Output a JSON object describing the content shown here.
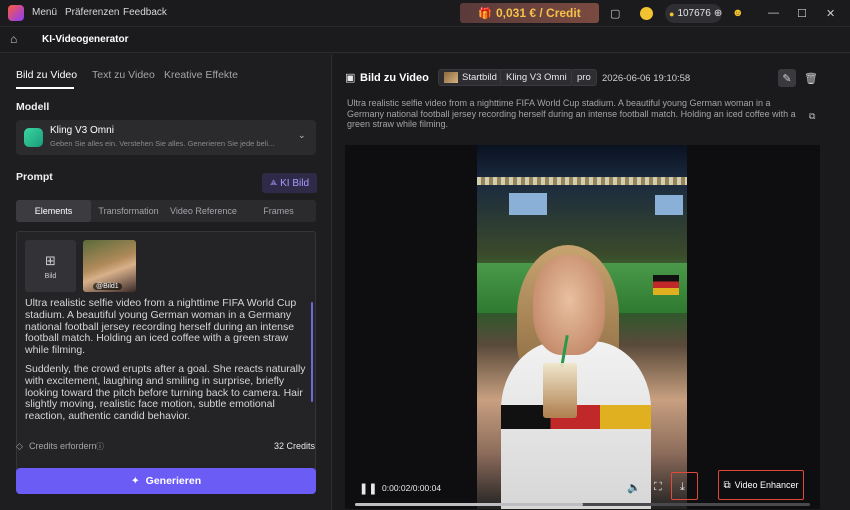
{
  "titlebar": {
    "menu": [
      "Menü",
      "Präferenzen",
      "Feedback"
    ],
    "credit_price": "0,031 € / Credit",
    "coins": "107676"
  },
  "secondbar": {
    "title": "KI-Videogenerator"
  },
  "left": {
    "tabs": [
      "Bild zu Video",
      "Text zu Video",
      "Kreative Effekte"
    ],
    "model_label": "Modell",
    "model_name": "Kling V3 Omni",
    "model_desc": "Geben Sie alles ein. Verstehen Sie alles. Generieren Sie jede beli...",
    "prompt_label": "Prompt",
    "ki_bild": "KI Bild",
    "segments": [
      "Elements",
      "Transformation",
      "Video Reference",
      "Frames"
    ],
    "add_label": "Bild",
    "thumb_tag": "@Bild1",
    "prompt_p1": "Ultra realistic selfie video from a nighttime FIFA World Cup stadium. A beautiful young German woman in a Germany national football jersey recording herself during an intense football match. Holding an iced coffee with a green straw while filming.",
    "prompt_p2": "Suddenly, the crowd erupts after a goal. She reacts naturally with excitement, laughing and smiling in surprise, briefly looking toward the pitch before turning back to camera. Hair slightly moving, realistic face motion, subtle emotional reaction, authentic candid behavior.",
    "credits_label": "Credits erfordern",
    "credits_value": "32 Credits",
    "generate": "Generieren"
  },
  "right": {
    "title": "Bild zu Video",
    "badge_startbild": "Startbild",
    "badge_model": "Kling V3 Omni",
    "badge_pro": "pro",
    "datetime": "2026-06-06 19:10:58",
    "description": "Ultra realistic selfie video from a nighttime FIFA World Cup stadium. A beautiful young German woman in a Germany national football jersey recording herself during an intense football match. Holding an iced coffee with a green straw while filming.",
    "time": "0:00:02/0:00:04",
    "progress": 0.5,
    "enhancer": "Video Enhancer"
  }
}
